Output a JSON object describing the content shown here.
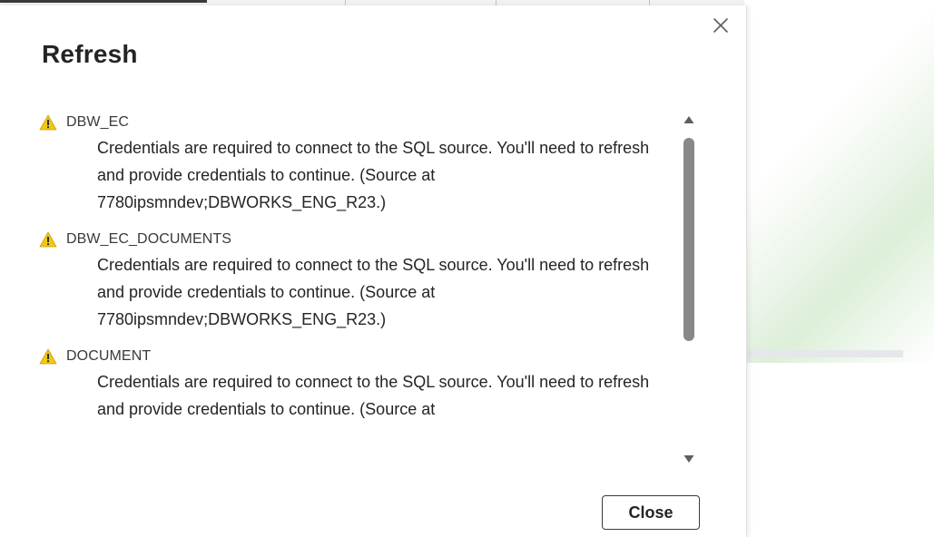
{
  "dialog": {
    "title": "Refresh",
    "close_icon": "close-icon",
    "close_button_label": "Close"
  },
  "items": [
    {
      "icon": "warning-icon",
      "name": "DBW_EC",
      "message": "Credentials are required to connect to the SQL source. You'll need to refresh and provide credentials to continue. (Source at 7780ipsmndev;DBWORKS_ENG_R23.)"
    },
    {
      "icon": "warning-icon",
      "name": "DBW_EC_DOCUMENTS",
      "message": "Credentials are required to connect to the SQL source. You'll need to refresh and provide credentials to continue. (Source at 7780ipsmndev;DBWORKS_ENG_R23.)"
    },
    {
      "icon": "warning-icon",
      "name": "DOCUMENT",
      "message": "Credentials are required to connect to the SQL source. You'll need to refresh and provide credentials to continue. (Source at"
    }
  ],
  "colors": {
    "warning_fill": "#f2c811",
    "warning_mark": "#323130",
    "text": "#252423",
    "scroll_thumb": "#8a8886"
  }
}
